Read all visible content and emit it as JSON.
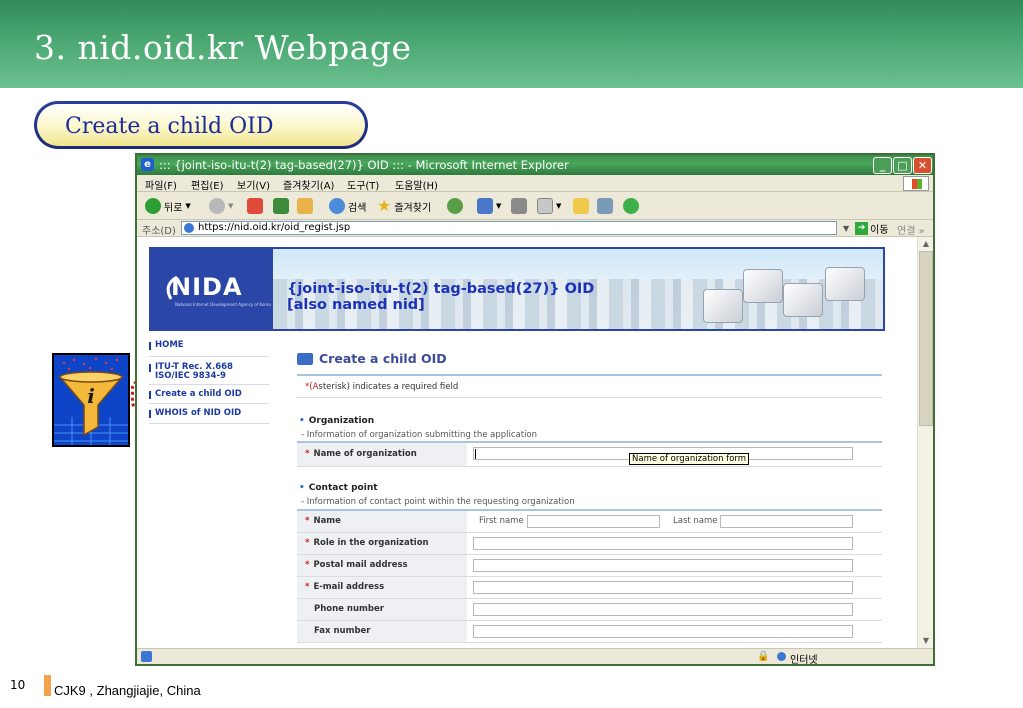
{
  "slide": {
    "title": "3. nid.oid.kr Webpage",
    "subtitle": "Create a child OID",
    "page_number": "10",
    "footer": "CJK9 , Zhangjiajie, China"
  },
  "browser": {
    "window_title": "::: {joint-iso-itu-t(2) tag-based(27)} OID ::: - Microsoft Internet Explorer",
    "menu": [
      "파일(F)",
      "편집(E)",
      "보기(V)",
      "즐겨찾기(A)",
      "도구(T)",
      "도움말(H)"
    ],
    "toolbar": {
      "back": "뒤로",
      "search": "검색",
      "favorites": "즐겨찾기"
    },
    "address_label": "주소(D)",
    "address_url": "https://nid.oid.kr/oid_regist.jsp",
    "go_label": "이동",
    "links_label": "연결 »",
    "status_zone": "인터넷"
  },
  "page": {
    "logo_text": "NIDA",
    "logo_subtext": "National Internet Development Agency of Korea",
    "banner_line1": "{joint-iso-itu-t(2) tag-based(27)} OID",
    "banner_line2": "[also named nid]",
    "nav": [
      {
        "label": "HOME"
      },
      {
        "label": "ITU-T Rec. X.668",
        "label2": "ISO/IEC 9834-9"
      },
      {
        "label": "Create a child OID"
      },
      {
        "label": "WHOIS of NID OID"
      }
    ],
    "form": {
      "title": "Create a child OID",
      "required_note": "*(Asterisk) indicates a required field",
      "org_section_title": "Organization",
      "org_section_desc": "- Information of organization submitting the application",
      "org_label": "Name of organization",
      "tooltip": "Name of organization form",
      "contact_section_title": "Contact point",
      "contact_section_desc": "- Information of contact point within the requesting organization",
      "name_label": "Name",
      "first_name_label": "First name",
      "last_name_label": "Last name",
      "role_label": "Role in the organization",
      "postal_label": "Postal mail address",
      "email_label": "E-mail address",
      "phone_label": "Phone number",
      "fax_label": "Fax number"
    }
  },
  "colors": {
    "header_green": "#4aa772",
    "pill_border": "#1c2a78",
    "title_blue": "#1b2a9a",
    "required_red": "#d11a1a",
    "accent_orange": "#f2a24a"
  }
}
